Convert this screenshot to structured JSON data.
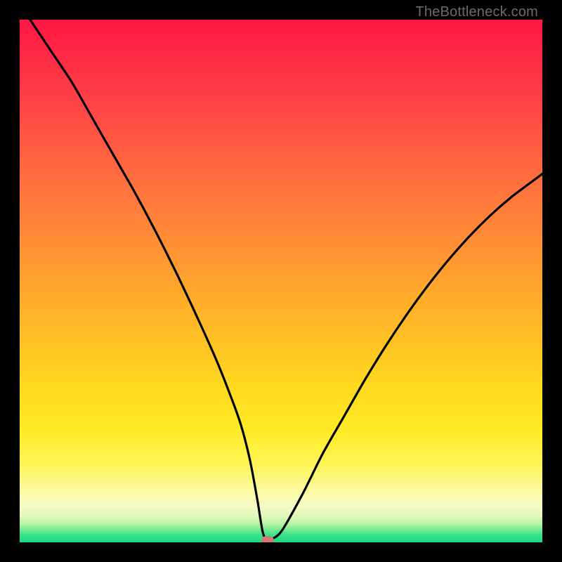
{
  "watermark": "TheBottleneck.com",
  "chart_data": {
    "type": "line",
    "title": "",
    "xlabel": "",
    "ylabel": "",
    "xlim": [
      0,
      100
    ],
    "ylim": [
      0,
      100
    ],
    "series": [
      {
        "name": "bottleneck-curve",
        "x": [
          2,
          6,
          10,
          14,
          18,
          22,
          26,
          30,
          34,
          38,
          42,
          44,
          45.5,
          46.5,
          47.5,
          50,
          54,
          58,
          62,
          66,
          70,
          74,
          78,
          82,
          86,
          90,
          94,
          98,
          100
        ],
        "y": [
          100,
          94,
          88,
          81,
          74,
          67,
          59.5,
          51.5,
          43,
          34,
          23.5,
          16,
          8,
          2,
          0.5,
          2,
          9,
          17,
          24,
          31,
          37.5,
          43.5,
          49,
          54,
          58.5,
          62.5,
          66,
          69,
          70.5
        ]
      }
    ],
    "marker": {
      "x": 47.5,
      "y": 0.4
    },
    "gradient_stops": [
      {
        "pos": 0,
        "color": "#ff1744"
      },
      {
        "pos": 50,
        "color": "#ffae2b"
      },
      {
        "pos": 80,
        "color": "#fff03a"
      },
      {
        "pos": 100,
        "color": "#18d983"
      }
    ]
  }
}
